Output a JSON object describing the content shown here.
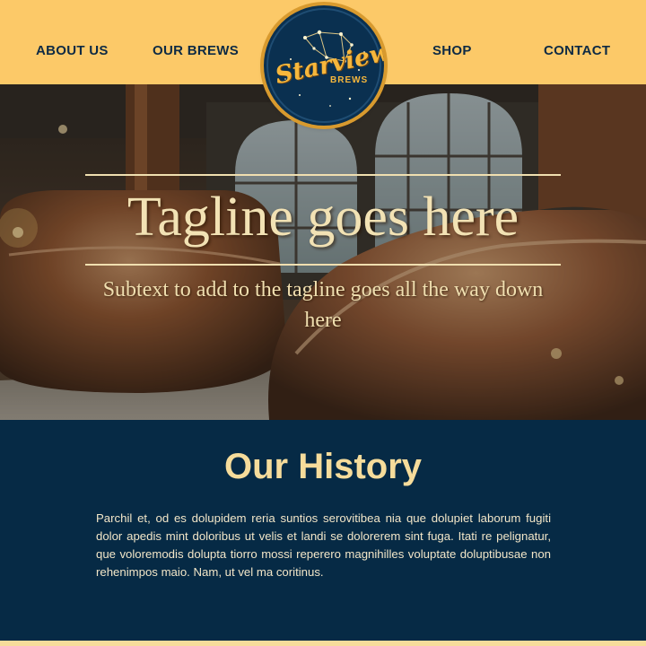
{
  "nav": {
    "left": [
      "ABOUT US",
      "OUR BREWS"
    ],
    "right": [
      "SHOP",
      "CONTACT"
    ]
  },
  "logo": {
    "wordmark": "Starview",
    "sub": "BREWS"
  },
  "hero": {
    "tagline": "Tagline goes here",
    "subtext": "Subtext to add to the tagline goes all the way down here"
  },
  "history": {
    "title": "Our History",
    "body": "Parchil et, od es dolupidem reria suntios serovitibea nia que dolupiet laborum fugiti dolor apedis mint doloribus ut velis et landi se dolorerem sint fuga. Itati re pelignatur, que voloremodis dolupta tiorro mossi reperero magnihilles voluptate doluptibusae non rehenimpos maio. Nam, ut vel ma coritinus."
  },
  "colors": {
    "header": "#fcc968",
    "navy": "#062a45",
    "cream": "#f6dc9b",
    "gold": "#f6b73c"
  }
}
